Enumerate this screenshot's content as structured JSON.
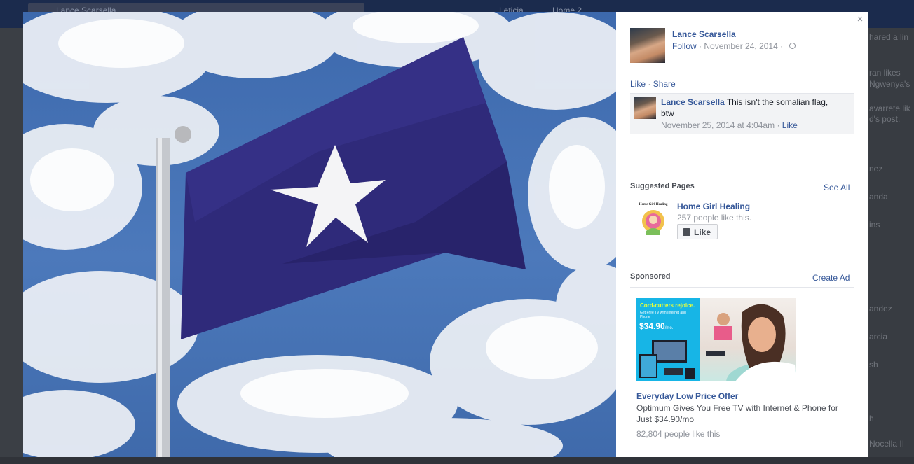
{
  "background": {
    "search_text": "Lance Scarsella",
    "nav_items": [
      "Leticia",
      "Home 2"
    ],
    "side_fragments": [
      "hared a lin",
      "ran likes",
      "Ngwenya's",
      "avarrete lik",
      "d's post.",
      "nez",
      "anda",
      "ins",
      "andez",
      "arcia",
      "sh",
      "h",
      "Nocella II"
    ]
  },
  "photo": {
    "subject": "flag-photo"
  },
  "panel": {
    "close_label": "×",
    "author": {
      "name": "Lance Scarsella",
      "follow_label": "Follow",
      "separator": " · ",
      "date": "November 24, 2014",
      "separator2": " · "
    },
    "actions": {
      "like_label": "Like",
      "separator": " · ",
      "share_label": "Share"
    },
    "comment": {
      "author": "Lance Scarsella",
      "text": " This isn't the somalian flag, btw",
      "timestamp": "November 25, 2014 at 4:04am",
      "separator": " · ",
      "like_label": "Like"
    },
    "suggested": {
      "title": "Suggested Pages",
      "see_all_label": "See All",
      "page_name": "Home Girl Healing",
      "likes": "257 people like this.",
      "like_button_label": "Like",
      "logo_text": "Home Girl Healing"
    },
    "sponsored": {
      "title": "Sponsored",
      "create_ad_label": "Create Ad",
      "ad_headline": "Cord-cutters rejoice.",
      "ad_subtext": "Get Free TV with Internet and Phone",
      "ad_price": "$34.90",
      "ad_price_suffix": "/mo.",
      "ad_title": "Everyday Low Price Offer",
      "ad_description": "Optimum Gives You Free TV with Internet & Phone for Just $34.90/mo",
      "ad_likes": "82,804 people like this"
    }
  },
  "colors": {
    "link": "#365899",
    "flag": "#2f2a7a",
    "sky": "#4a78ba"
  }
}
